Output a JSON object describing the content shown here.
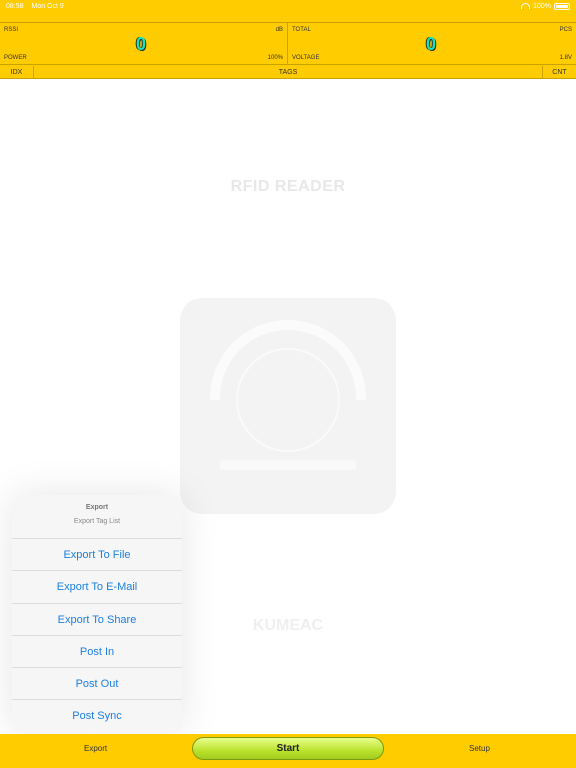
{
  "status_bar": {
    "time": "08:58",
    "date": "Mon Oct 9",
    "battery": "100%"
  },
  "header": {
    "rssi_label": "RSSI",
    "rssi_unit": "dB",
    "rssi_value": "0",
    "power_label": "POWER",
    "power_value": "100%",
    "total_label": "TOTAL",
    "total_unit": "PCS",
    "total_value": "0",
    "voltage_label": "VOLTAGE",
    "voltage_value": "1.8V"
  },
  "columns": {
    "idx": "IDX",
    "tags": "TAGS",
    "cnt": "CNT"
  },
  "background": {
    "title": "RFID READER",
    "brand": "KUMEAC"
  },
  "export_popover": {
    "title": "Export",
    "subtitle": "Export Tag List",
    "items": [
      "Export To File",
      "Export To E-Mail",
      "Export To Share",
      "Post In",
      "Post Out",
      "Post Sync"
    ]
  },
  "tabbar": {
    "export": "Export",
    "start": "Start",
    "setup": "Setup"
  },
  "colors": {
    "accent": "#FFCC00",
    "link": "#1a7fe0",
    "counter": "#19e3b8",
    "start_button": "#b9e22e"
  },
  "icons": [
    "wifi-icon",
    "battery-icon"
  ]
}
